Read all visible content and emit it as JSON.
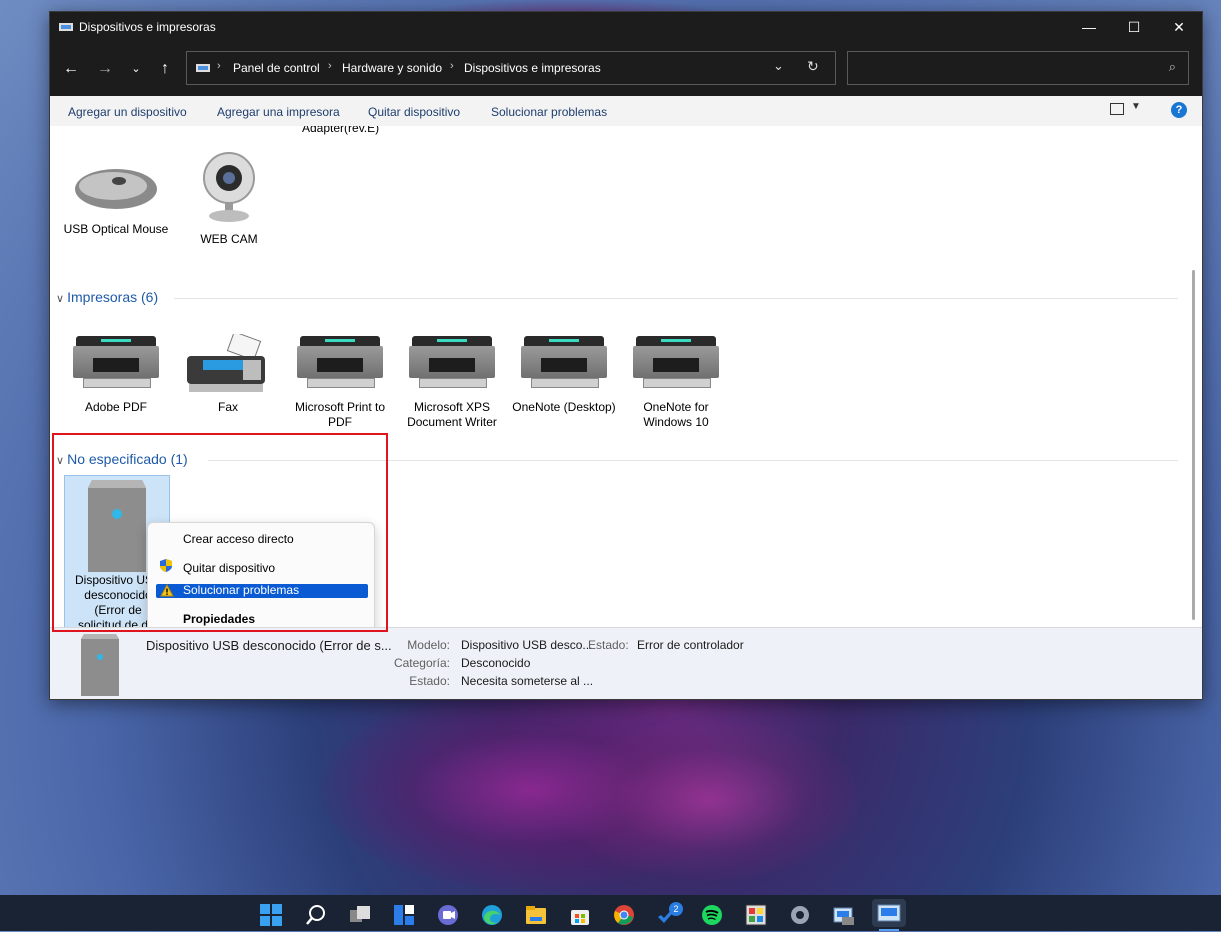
{
  "window": {
    "title": "Dispositivos e impresoras"
  },
  "nav": {
    "breadcrumb": [
      "Panel de control",
      "Hardware y sonido",
      "Dispositivos e impresoras"
    ],
    "search_placeholder": ""
  },
  "toolbar": {
    "items": [
      "Agregar un dispositivo",
      "Agregar una impresora",
      "Quitar dispositivo",
      "Solucionar problemas"
    ]
  },
  "devices": {
    "partial_label": "Adapter(rev.E)",
    "items": [
      {
        "label": "USB Optical Mouse"
      },
      {
        "label": "WEB CAM"
      }
    ]
  },
  "printers": {
    "header": "Impresoras (6)",
    "items": [
      {
        "label": "Adobe PDF"
      },
      {
        "label": "Fax"
      },
      {
        "label": "Microsoft Print to PDF"
      },
      {
        "label": "Microsoft XPS Document Writer"
      },
      {
        "label": "OneNote (Desktop)"
      },
      {
        "label": "OneNote for Windows 10"
      }
    ]
  },
  "unspecified": {
    "header": "No especificado (1)",
    "device_label": "Dispositivo USB desconocido (Error de solicitud de d..."
  },
  "context_menu": {
    "items": [
      "Crear acceso directo",
      "Quitar dispositivo",
      "Solucionar problemas",
      "Propiedades"
    ]
  },
  "details": {
    "name": "Dispositivo USB desconocido (Error de s...",
    "modelo_label": "Modelo:",
    "modelo_value": "Dispositivo USB desco...",
    "estado_label": "Estado:",
    "estado_value": "Error de controlador",
    "categoria_label": "Categoría:",
    "categoria_value": "Desconocido",
    "estado2_label": "Estado:",
    "estado2_value": "Necesita someterse al ..."
  },
  "taskbar": {
    "icons": [
      "windows-start-icon",
      "search-icon",
      "task-view-icon",
      "widgets-icon",
      "teams-chat-icon",
      "edge-icon",
      "file-explorer-icon",
      "store-icon",
      "chrome-icon",
      "steam-icon",
      "spotify-icon",
      "paint-icon",
      "settings-icon",
      "control-panel-icon",
      "devices-printers-icon"
    ],
    "steam_badge": "2"
  }
}
